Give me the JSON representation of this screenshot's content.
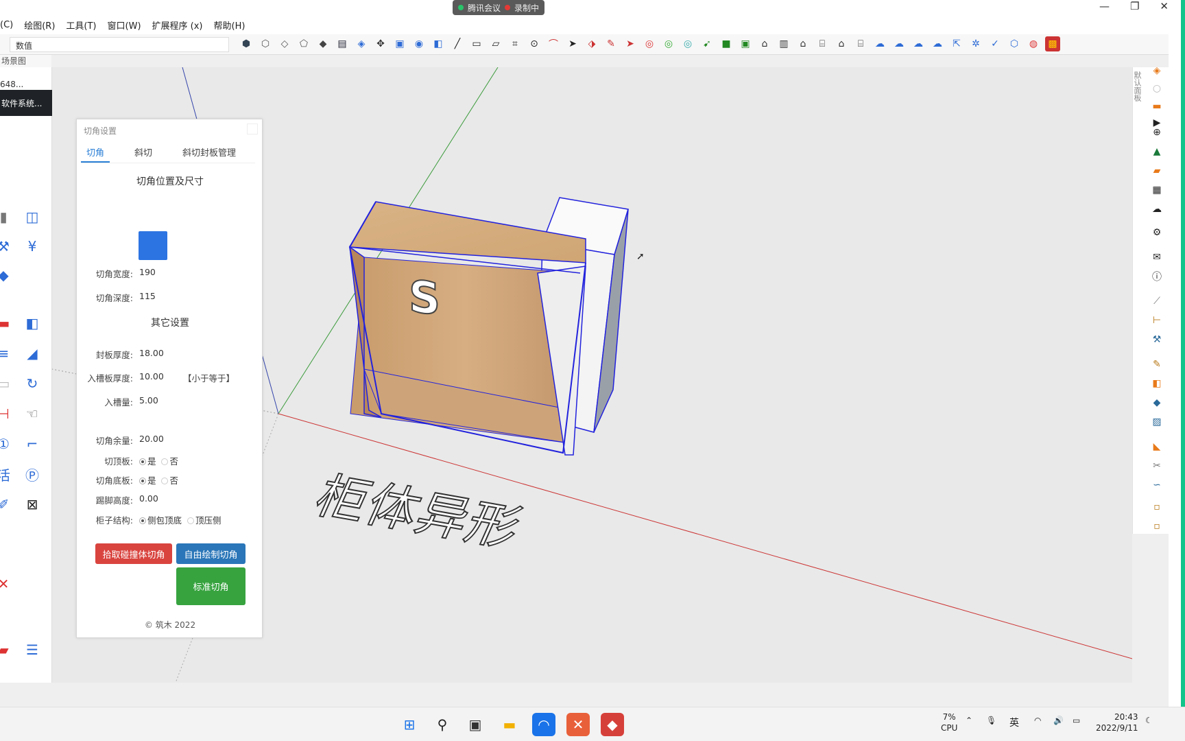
{
  "meeting": {
    "app": "腾讯会议",
    "recording": "录制中"
  },
  "menu": {
    "items": [
      "(C)",
      "绘图(R)",
      "工具(T)",
      "窗口(W)",
      "扩展程序 (x)",
      "帮助(H)"
    ]
  },
  "window_controls": {
    "minimize": "—",
    "restore": "❐",
    "close": "✕"
  },
  "toolbar": {
    "value_label": "数值"
  },
  "scene_tab": "场景图",
  "left_palette": {
    "tooltip_top": "648...",
    "tooltip": "软件系统..."
  },
  "dialog": {
    "title": "切角设置",
    "tabs": [
      "切角",
      "斜切",
      "斜切封板管理"
    ],
    "section_size": "切角位置及尺寸",
    "corner_width": {
      "label": "切角宽度:",
      "value": "190"
    },
    "corner_depth": {
      "label": "切角深度:",
      "value": "115"
    },
    "section_other": "其它设置",
    "panel_thickness": {
      "label": "封板厚度:",
      "value": "18.00"
    },
    "groove_thickness": {
      "label": "入槽板厚度:",
      "value": "10.00",
      "hint": "【小于等于】"
    },
    "groove_amount": {
      "label": "入槽量:",
      "value": "5.00"
    },
    "corner_margin": {
      "label": "切角余量:",
      "value": "20.00"
    },
    "cut_top": {
      "label": "切顶板:",
      "yes": "是",
      "no": "否"
    },
    "cut_bottom": {
      "label": "切角底板:",
      "yes": "是",
      "no": "否"
    },
    "kick_height": {
      "label": "踢脚高度:",
      "value": "0.00"
    },
    "cabinet_structure": {
      "label": "柜子结构:",
      "opt1": "侧包顶底",
      "opt2": "顶压侧"
    },
    "btn_pick": "拾取碰撞体切角",
    "btn_free": "自由绘制切角",
    "btn_standard": "标准切角",
    "copyright": "© 筑木 2022"
  },
  "viewport": {
    "text_3d": "柜体异形",
    "letter_3d": "S"
  },
  "right_panel": {
    "default_tray": "默认面板"
  },
  "taskbar": {
    "cpu_percent": "7%",
    "cpu_label": "CPU",
    "ime": "英",
    "time": "20:43",
    "date": "2022/9/11"
  },
  "colors": {
    "accent": "#2a7fd6",
    "red_btn": "#d9443f",
    "blue_btn": "#2a76b8",
    "green_btn": "#37a33f"
  }
}
